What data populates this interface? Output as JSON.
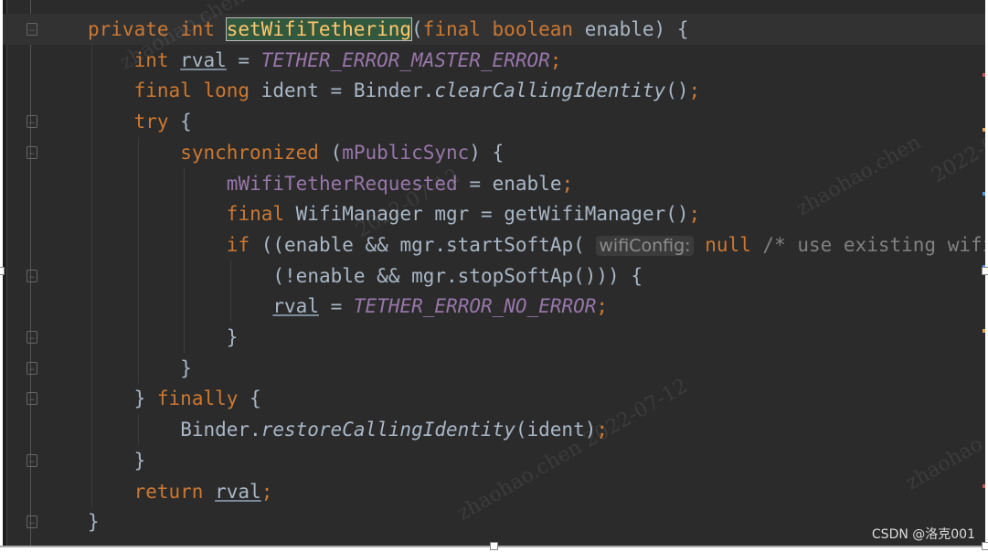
{
  "editor": {
    "colors": {
      "background": "#2b2b2b",
      "keyword": "#cc7832",
      "field": "#9876aa",
      "text": "#a9b7c6",
      "method_declaration": "#ffc66d",
      "comment": "#808080"
    },
    "lines": [
      {
        "indent": 0,
        "tokens": [
          {
            "t": "private int ",
            "c": "kw"
          },
          {
            "t": "setWifiTethering",
            "c": "decl"
          },
          {
            "t": "("
          },
          {
            "t": "final boolean ",
            "c": "kw"
          },
          {
            "t": "enable) {"
          }
        ]
      },
      {
        "indent": 1,
        "tokens": [
          {
            "t": "int ",
            "c": "kw"
          },
          {
            "t": "rval",
            "c": "ul"
          },
          {
            "t": " = "
          },
          {
            "t": "TETHER_ERROR_MASTER_ERROR",
            "c": "const"
          },
          {
            "t": ";",
            "c": "kw"
          }
        ]
      },
      {
        "indent": 1,
        "tokens": [
          {
            "t": "final long ",
            "c": "kw"
          },
          {
            "t": "ident = Binder."
          },
          {
            "t": "clearCallingIdentity",
            "c": "static"
          },
          {
            "t": "()"
          },
          {
            "t": ";",
            "c": "kw"
          }
        ]
      },
      {
        "indent": 1,
        "tokens": [
          {
            "t": "try ",
            "c": "kw"
          },
          {
            "t": "{"
          }
        ]
      },
      {
        "indent": 2,
        "tokens": [
          {
            "t": "synchronized ",
            "c": "kw"
          },
          {
            "t": "("
          },
          {
            "t": "mPublicSync",
            "c": "fld"
          },
          {
            "t": ") {"
          }
        ]
      },
      {
        "indent": 3,
        "tokens": [
          {
            "t": "mWifiTetherRequested",
            "c": "fld"
          },
          {
            "t": " = enable"
          },
          {
            "t": ";",
            "c": "kw"
          }
        ]
      },
      {
        "indent": 3,
        "tokens": [
          {
            "t": "final ",
            "c": "kw"
          },
          {
            "t": "WifiManager mgr = getWifiManager()"
          },
          {
            "t": ";",
            "c": "kw"
          }
        ]
      },
      {
        "indent": 3,
        "tokens": [
          {
            "t": "if ",
            "c": "kw"
          },
          {
            "t": "((enable && mgr.startSoftAp( "
          },
          {
            "t": "wifiConfig:",
            "c": "hint"
          },
          {
            "t": " "
          },
          {
            "t": "null ",
            "c": "kw"
          },
          {
            "t": "/* use existing wifi",
            "c": "cm"
          }
        ]
      },
      {
        "indent": 4,
        "tokens": [
          {
            "t": "(!enable && mgr.stopSoftAp())) {"
          }
        ]
      },
      {
        "indent": 4,
        "tokens": [
          {
            "t": "rval",
            "c": "ul"
          },
          {
            "t": " = "
          },
          {
            "t": "TETHER_ERROR_NO_ERROR",
            "c": "const"
          },
          {
            "t": ";",
            "c": "kw"
          }
        ]
      },
      {
        "indent": 3,
        "tokens": [
          {
            "t": "}"
          }
        ]
      },
      {
        "indent": 2,
        "tokens": [
          {
            "t": "}"
          }
        ]
      },
      {
        "indent": 1,
        "tokens": [
          {
            "t": "} "
          },
          {
            "t": "finally ",
            "c": "kw"
          },
          {
            "t": "{"
          }
        ]
      },
      {
        "indent": 2,
        "tokens": [
          {
            "t": "Binder."
          },
          {
            "t": "restoreCallingIdentity",
            "c": "static"
          },
          {
            "t": "(ident)"
          },
          {
            "t": ";",
            "c": "kw"
          }
        ]
      },
      {
        "indent": 1,
        "tokens": [
          {
            "t": "}"
          }
        ]
      },
      {
        "indent": 1,
        "tokens": [
          {
            "t": "return ",
            "c": "kw"
          },
          {
            "t": "rval",
            "c": "ul"
          },
          {
            "t": ";",
            "c": "kw"
          }
        ]
      },
      {
        "indent": 0,
        "tokens": [
          {
            "t": "}"
          }
        ]
      }
    ]
  },
  "watermarks": [
    "zhaohao.chen",
    "2022-07-12",
    "zhaohao.chen 2022-07-12",
    "zhaohao.chen",
    "2022-07-12",
    "zhaohao.chen"
  ],
  "credit": "CSDN @洛克001"
}
